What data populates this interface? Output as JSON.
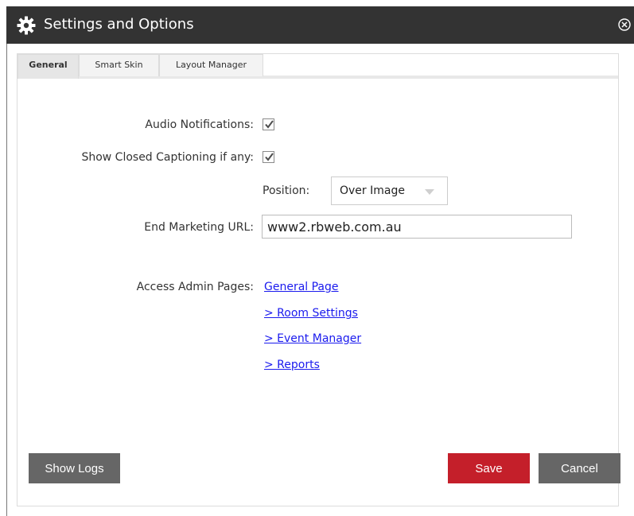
{
  "window": {
    "title": "Settings and Options",
    "title_icon": "gear-icon",
    "close_icon": "close-circle-icon"
  },
  "tabs": [
    {
      "label": "General",
      "active": true
    },
    {
      "label": "Smart Skin",
      "active": false
    },
    {
      "label": "Layout Manager",
      "active": false
    }
  ],
  "general": {
    "audio_notifications": {
      "label": "Audio Notifications:",
      "checked": true
    },
    "closed_captioning": {
      "label": "Show Closed Captioning if any:",
      "checked": true
    },
    "position": {
      "label": "Position:",
      "value": "Over Image"
    },
    "end_marketing_url": {
      "label": "End Marketing URL:",
      "value": "www2.rbweb.com.au"
    },
    "admin_pages": {
      "label": "Access Admin Pages:",
      "links": [
        "General Page",
        "> Room Settings",
        "> Event Manager",
        "> Reports"
      ]
    }
  },
  "buttons": {
    "show_logs": "Show Logs",
    "save": "Save",
    "cancel": "Cancel"
  },
  "colors": {
    "titlebar": "#333333",
    "save": "#c41f2a",
    "secondary_button": "#666666",
    "link": "#1a1aee"
  }
}
